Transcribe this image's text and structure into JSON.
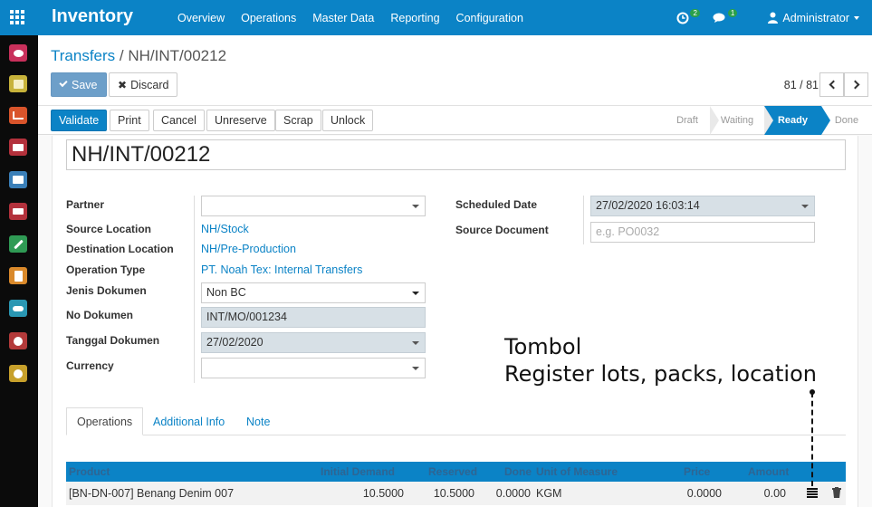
{
  "topbar": {
    "brand": "Inventory",
    "menu": [
      "Overview",
      "Operations",
      "Master Data",
      "Reporting",
      "Configuration"
    ],
    "activity_count": "2",
    "messages_count": "1",
    "user": "Administrator"
  },
  "control_panel": {
    "breadcrumb_parent": "Transfers",
    "breadcrumb_sep": "/",
    "breadcrumb_current": "NH/INT/00212",
    "save_label": "Save",
    "discard_label": "Discard",
    "pager": "81 / 81"
  },
  "statusbar": {
    "buttons": [
      "Validate",
      "Print",
      "Cancel",
      "Unreserve",
      "Scrap",
      "Unlock"
    ],
    "stages": [
      "Draft",
      "Waiting",
      "Ready",
      "Done"
    ],
    "active_stage": "Ready"
  },
  "form": {
    "name": "NH/INT/00212",
    "partner_label": "Partner",
    "partner_value": "",
    "source_location_label": "Source Location",
    "source_location_value": "NH/Stock",
    "destination_location_label": "Destination Location",
    "destination_location_value": "NH/Pre-Production",
    "operation_type_label": "Operation Type",
    "operation_type_value": "PT. Noah Tex: Internal Transfers",
    "jenis_dokumen_label": "Jenis Dokumen",
    "jenis_dokumen_value": "Non BC",
    "no_dokumen_label": "No Dokumen",
    "no_dokumen_value": "INT/MO/001234",
    "tanggal_dokumen_label": "Tanggal Dokumen",
    "tanggal_dokumen_value": "27/02/2020",
    "currency_label": "Currency",
    "currency_value": "",
    "scheduled_date_label": "Scheduled Date",
    "scheduled_date_value": "27/02/2020 16:03:14",
    "source_document_label": "Source Document",
    "source_document_placeholder": "e.g. PO0032"
  },
  "tabs": [
    "Operations",
    "Additional Info",
    "Note"
  ],
  "table": {
    "headers": [
      "Product",
      "Initial Demand",
      "Reserved",
      "Done",
      "Unit of Measure",
      "Price",
      "Amount"
    ],
    "rows": [
      {
        "product": "[BN-DN-007] Benang Denim 007",
        "initial_demand": "10.5000",
        "reserved": "10.5000",
        "done": "0.0000",
        "uom": "KGM",
        "price": "0.0000",
        "amount": "0.00"
      }
    ]
  },
  "annotation": {
    "line1": "Tombol",
    "line2": "Register lots, packs, location"
  },
  "colors": {
    "primary": "#0b83c6",
    "sidebar": "#0b0b0b",
    "readonly_field": "#d7e0e6"
  }
}
